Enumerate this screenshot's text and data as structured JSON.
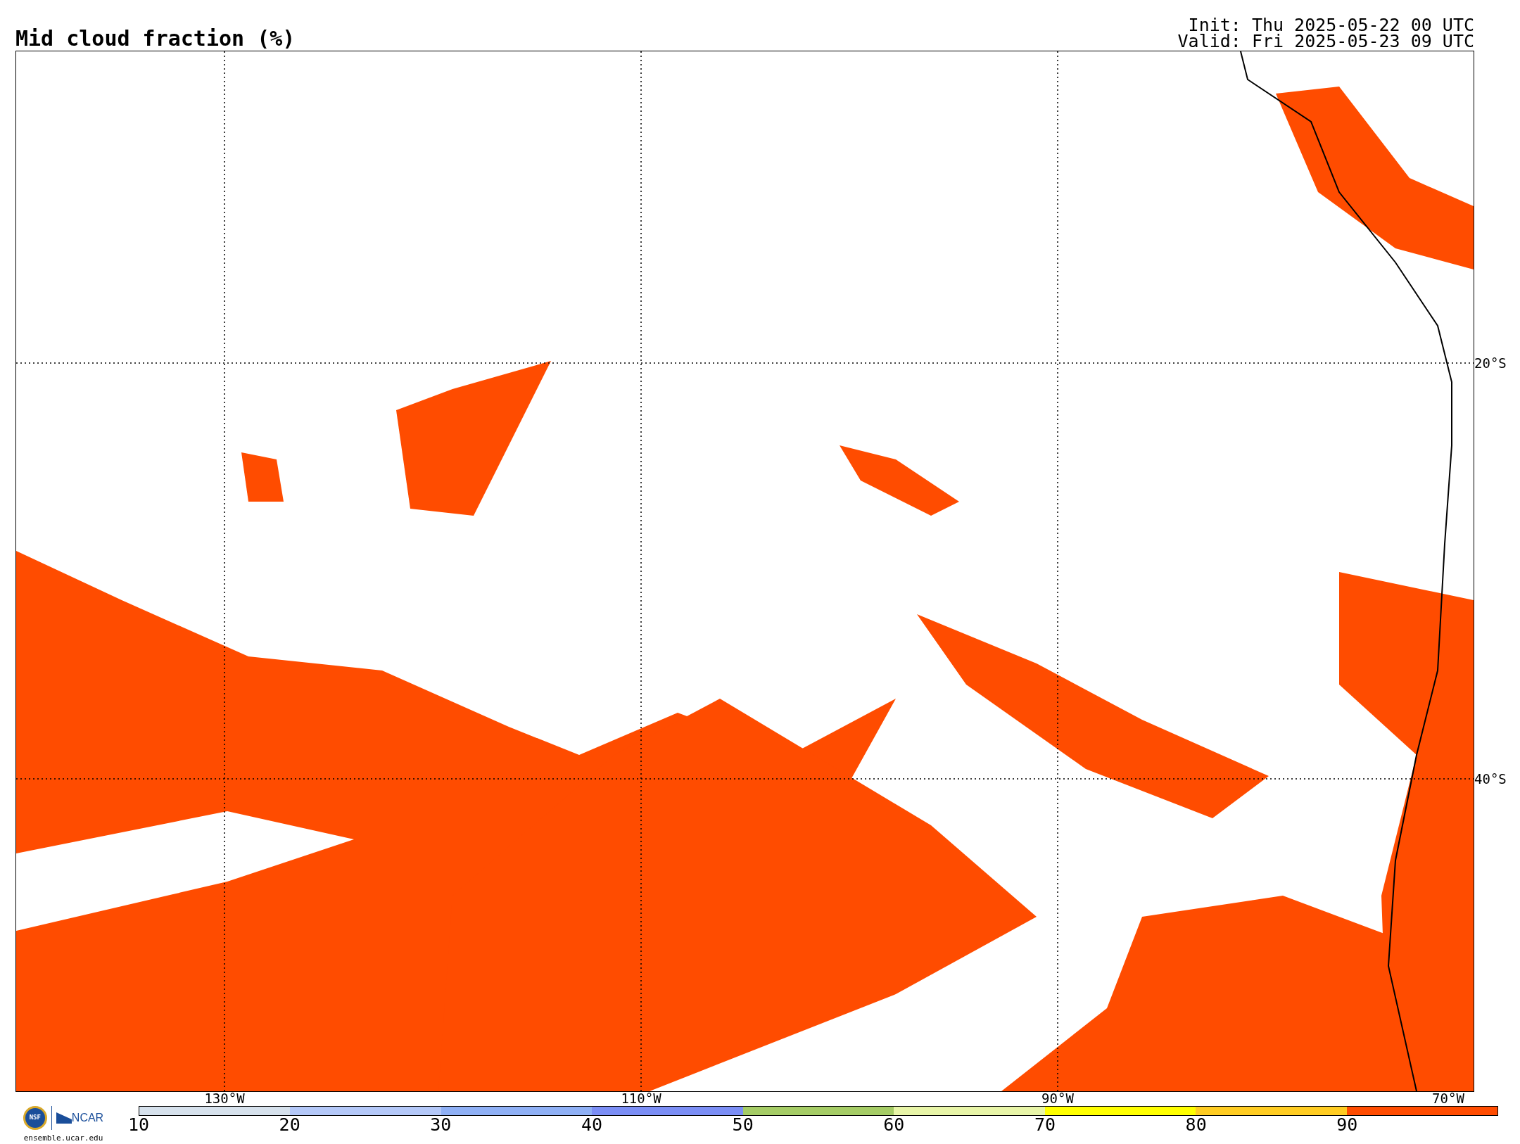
{
  "title": "Mid cloud fraction (%)",
  "init": "Init: Thu 2025-05-22 00 UTC",
  "valid": "Valid: Fri 2025-05-23 09 UTC",
  "map": {
    "lat_labels": [
      "20°S",
      "40°S"
    ],
    "lon_labels": [
      "130°W",
      "110°W",
      "90°W",
      "70°W"
    ]
  },
  "logos": {
    "nsf": "NSF",
    "ncar": "NCAR",
    "site": "ensemble.ucar.edu"
  },
  "colorbar": {
    "segments": [
      {
        "label": "10",
        "color": "#d6e1ec"
      },
      {
        "label": "20",
        "color": "#b4c8f8"
      },
      {
        "label": "30",
        "color": "#8fb0f5"
      },
      {
        "label": "40",
        "color": "#7b8ef5"
      },
      {
        "label": "50",
        "color": "#a5cc66"
      },
      {
        "label": "60",
        "color": "#e8f5a8"
      },
      {
        "label": "70",
        "color": "#ffff00"
      },
      {
        "label": "80",
        "color": "#ffcc22"
      },
      {
        "label": "90",
        "color": "#ff4c00"
      }
    ]
  }
}
